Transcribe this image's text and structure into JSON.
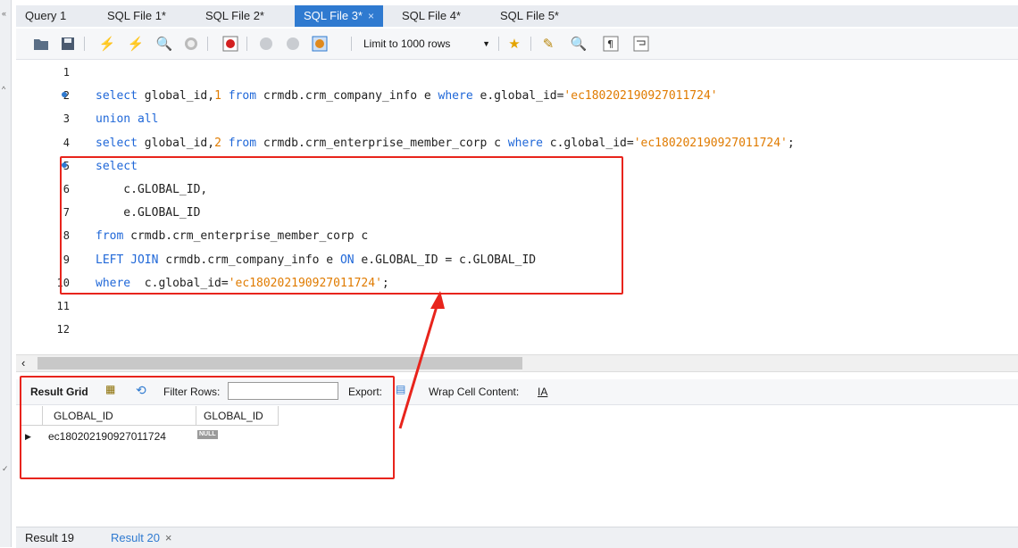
{
  "tabs": [
    {
      "label": "Query 1",
      "active": false
    },
    {
      "label": "SQL File 1*",
      "active": false
    },
    {
      "label": "SQL File 2*",
      "active": false
    },
    {
      "label": "SQL File 3*",
      "active": true,
      "close": "×"
    },
    {
      "label": "SQL File 4*",
      "active": false
    },
    {
      "label": "SQL File 5*",
      "active": false
    }
  ],
  "toolbar": {
    "limit_select": "Limit to 1000 rows",
    "icons": [
      "open-folder-icon",
      "save-icon",
      "execute-icon",
      "execute-current-icon",
      "explain-icon",
      "stop-icon",
      "toggle-error-icon",
      "commit-icon",
      "rollback-icon",
      "autocommit-icon",
      "bookmark-star-icon",
      "beautify-icon",
      "find-icon",
      "invisible-chars-icon",
      "wrap-icon"
    ]
  },
  "editor": {
    "lines": [
      {
        "n": "1",
        "dot": false,
        "code": []
      },
      {
        "n": "2",
        "dot": true,
        "code": [
          {
            "t": "select",
            "c": "kw"
          },
          {
            "t": " global_id,"
          },
          {
            "t": "1",
            "c": "num"
          },
          {
            "t": " "
          },
          {
            "t": "from",
            "c": "kw"
          },
          {
            "t": " crmdb.crm_company_info e "
          },
          {
            "t": "where",
            "c": "kw"
          },
          {
            "t": " e.global_id="
          },
          {
            "t": "'ec180202190927011724'",
            "c": "str"
          }
        ]
      },
      {
        "n": "3",
        "dot": false,
        "code": [
          {
            "t": "union all",
            "c": "kw"
          }
        ]
      },
      {
        "n": "4",
        "dot": false,
        "code": [
          {
            "t": "select",
            "c": "kw"
          },
          {
            "t": " global_id,"
          },
          {
            "t": "2",
            "c": "num"
          },
          {
            "t": " "
          },
          {
            "t": "from",
            "c": "kw"
          },
          {
            "t": " crmdb.crm_enterprise_member_corp c "
          },
          {
            "t": "where",
            "c": "kw"
          },
          {
            "t": " c.global_id="
          },
          {
            "t": "'ec180202190927011724'",
            "c": "str"
          },
          {
            "t": ";"
          }
        ]
      },
      {
        "n": "5",
        "dot": true,
        "code": [
          {
            "t": "select",
            "c": "kw"
          }
        ]
      },
      {
        "n": "6",
        "dot": false,
        "code": [
          {
            "t": "    c.GLOBAL_ID,"
          }
        ]
      },
      {
        "n": "7",
        "dot": false,
        "code": [
          {
            "t": "    e.GLOBAL_ID"
          }
        ]
      },
      {
        "n": "8",
        "dot": false,
        "code": [
          {
            "t": "from",
            "c": "kw"
          },
          {
            "t": " crmdb.crm_enterprise_member_corp c"
          }
        ]
      },
      {
        "n": "9",
        "dot": false,
        "code": [
          {
            "t": "LEFT JOIN",
            "c": "kw"
          },
          {
            "t": " crmdb.crm_company_info e "
          },
          {
            "t": "ON",
            "c": "kw"
          },
          {
            "t": " e.GLOBAL_ID = c.GLOBAL_ID"
          }
        ]
      },
      {
        "n": "10",
        "dot": false,
        "code": [
          {
            "t": "where",
            "c": "kw"
          },
          {
            "t": "  c.global_id="
          },
          {
            "t": "'ec180202190927011724'",
            "c": "str"
          },
          {
            "t": ";"
          }
        ]
      },
      {
        "n": "11",
        "dot": false,
        "code": []
      },
      {
        "n": "12",
        "dot": false,
        "code": []
      }
    ]
  },
  "results": {
    "result_grid_label": "Result Grid",
    "filter_rows_label": "Filter Rows:",
    "filter_value": "",
    "export_label": "Export:",
    "wrap_label": "Wrap Cell Content:",
    "columns": [
      "GLOBAL_ID",
      "GLOBAL_ID"
    ],
    "row": {
      "col1": "ec180202190927011724",
      "col2": "NULL"
    }
  },
  "bottom_tabs": [
    {
      "label": "Result 19",
      "active": false
    },
    {
      "label": "Result 20",
      "active": true,
      "close": "×"
    }
  ],
  "colors": {
    "accent": "#2f7ad0",
    "keyword": "#1f67d8",
    "literal": "#e07b00",
    "annotation": "#e8241c"
  }
}
